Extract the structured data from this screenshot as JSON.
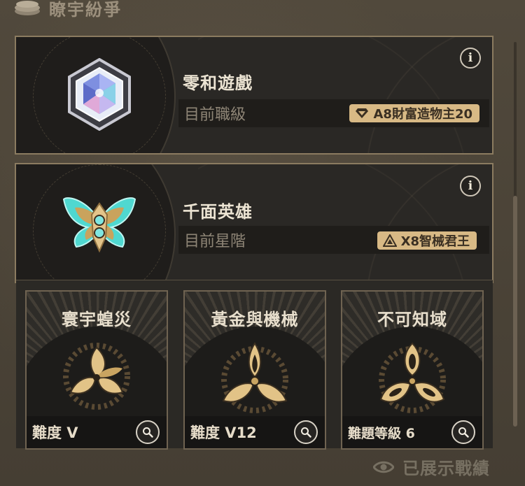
{
  "header": {
    "title": "瞭宇紛爭",
    "icon": "coin-stack-icon"
  },
  "cards": [
    {
      "name": "零和遊戲",
      "rank_label": "目前職級",
      "badge": "A8財富造物主20",
      "badge_icon": "diamond-rank-icon",
      "emblem_icon": "crystal-hexagon-icon",
      "info_label": "i"
    },
    {
      "name": "千面英雄",
      "rank_label": "目前星階",
      "badge": "Ⅹ8智械君王",
      "badge_icon": "triangle-rank-icon",
      "emblem_icon": "butterfly-emblem-icon",
      "info_label": "i"
    }
  ],
  "modes": [
    {
      "title": "寰宇蝗災",
      "difficulty": "難度 Ⅴ",
      "emblem_icon": "swarm-emblem-icon"
    },
    {
      "title": "黃金與機械",
      "difficulty": "難度 Ⅴ12",
      "emblem_icon": "gold-gear-emblem-icon"
    },
    {
      "title": "不可知域",
      "difficulty": "難題等級 6",
      "emblem_icon": "unknowable-emblem-icon"
    }
  ],
  "footer": {
    "label": "已展示戰績",
    "icon": "eye-icon"
  },
  "colors": {
    "accent": "#d8b985",
    "border": "#8b7b60",
    "background": "#4d4539"
  }
}
